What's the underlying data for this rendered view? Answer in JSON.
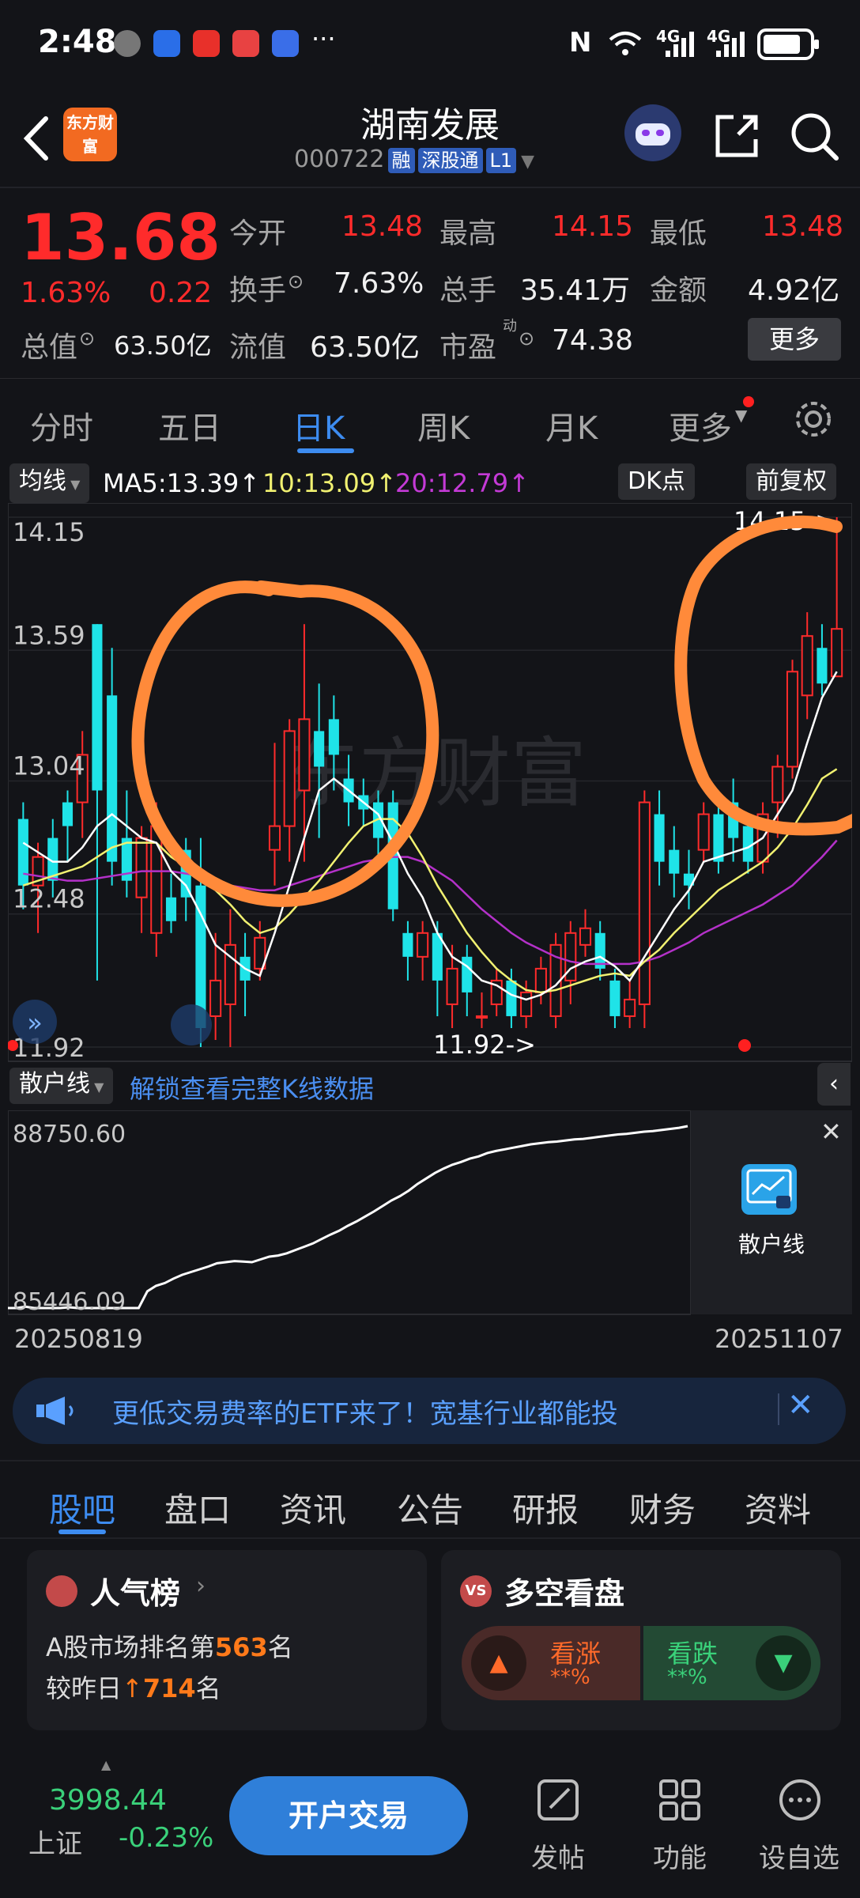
{
  "status_bar": {
    "time": "2:48",
    "signal_1": "4G",
    "signal_2": "4G"
  },
  "header": {
    "logo_text": "东方财富",
    "title": "湖南发展",
    "code": "000722",
    "tags": [
      "融",
      "深股通",
      "L1"
    ]
  },
  "quote": {
    "price": "13.68",
    "change_pct": "1.63%",
    "change": "0.22",
    "fields": [
      {
        "label": "今开",
        "value": "13.48"
      },
      {
        "label": "最高",
        "value": "14.15"
      },
      {
        "label": "最低",
        "value": "13.48"
      },
      {
        "label": "换手",
        "value": "7.63%"
      },
      {
        "label": "总手",
        "value": "35.41万"
      },
      {
        "label": "金额",
        "value": "4.92亿"
      },
      {
        "label": "总值",
        "value": "63.50亿"
      },
      {
        "label": "流值",
        "value": "63.50亿"
      },
      {
        "label": "市盈",
        "sup": "动",
        "value": "74.38"
      }
    ],
    "more_label": "更多"
  },
  "period_tabs": {
    "items": [
      "分时",
      "五日",
      "日K",
      "周K",
      "月K",
      "更多"
    ],
    "active": "日K"
  },
  "indicator_bar": {
    "selector": "均线",
    "ma5": "MA5:13.39",
    "ma10": "10:13.09",
    "ma20": "20:12.79",
    "dk_label": "DK点",
    "fq_label": "前复权"
  },
  "sub_indicator": {
    "selector": "散户线",
    "unlock_text": "解锁查看完整K线数据",
    "panel_label": "散户线"
  },
  "chart_data": [
    {
      "type": "candlestick",
      "axis_ticks": [
        "14.15",
        "13.59",
        "13.04",
        "12.48",
        "11.92"
      ],
      "ylim": [
        11.92,
        14.15
      ],
      "annotations": [
        "14.15->",
        "11.92->"
      ],
      "watermark": "东方财富",
      "candles": [
        {
          "o": 12.88,
          "c": 12.6,
          "h": 12.95,
          "l": 12.5
        },
        {
          "o": 12.6,
          "c": 12.72,
          "h": 12.78,
          "l": 12.4
        },
        {
          "o": 12.8,
          "c": 12.62,
          "h": 12.88,
          "l": 12.55
        },
        {
          "o": 12.95,
          "c": 12.85,
          "h": 13.0,
          "l": 12.7
        },
        {
          "o": 12.95,
          "c": 13.15,
          "h": 13.25,
          "l": 12.8
        },
        {
          "o": 13.7,
          "c": 13.0,
          "h": 13.7,
          "l": 12.2
        },
        {
          "o": 13.4,
          "c": 12.7,
          "h": 13.6,
          "l": 12.6
        },
        {
          "o": 12.8,
          "c": 12.62,
          "h": 13.0,
          "l": 12.55
        },
        {
          "o": 12.55,
          "c": 12.8,
          "h": 12.85,
          "l": 12.4
        },
        {
          "o": 12.4,
          "c": 12.85,
          "h": 12.95,
          "l": 12.3
        },
        {
          "o": 12.55,
          "c": 12.45,
          "h": 12.65,
          "l": 12.4
        },
        {
          "o": 12.75,
          "c": 12.55,
          "h": 12.8,
          "l": 12.45
        },
        {
          "o": 12.6,
          "c": 12.0,
          "h": 12.8,
          "l": 11.92
        },
        {
          "o": 12.05,
          "c": 12.2,
          "h": 12.4,
          "l": 11.95
        },
        {
          "o": 12.1,
          "c": 12.35,
          "h": 12.5,
          "l": 11.92
        },
        {
          "o": 12.3,
          "c": 12.2,
          "h": 12.4,
          "l": 12.05
        },
        {
          "o": 12.25,
          "c": 12.38,
          "h": 12.45,
          "l": 12.2
        },
        {
          "o": 12.75,
          "c": 12.85,
          "h": 13.2,
          "l": 12.6
        },
        {
          "o": 12.85,
          "c": 13.25,
          "h": 13.3,
          "l": 12.7
        },
        {
          "o": 13.0,
          "c": 13.3,
          "h": 13.7,
          "l": 12.7
        },
        {
          "o": 13.25,
          "c": 13.1,
          "h": 13.45,
          "l": 12.8
        },
        {
          "o": 13.3,
          "c": 13.15,
          "h": 13.4,
          "l": 13.0
        },
        {
          "o": 13.05,
          "c": 12.95,
          "h": 13.15,
          "l": 12.85
        },
        {
          "o": 12.98,
          "c": 12.92,
          "h": 13.05,
          "l": 12.85
        },
        {
          "o": 12.95,
          "c": 12.8,
          "h": 13.0,
          "l": 12.7
        },
        {
          "o": 12.95,
          "c": 12.5,
          "h": 13.0,
          "l": 12.45
        },
        {
          "o": 12.4,
          "c": 12.3,
          "h": 12.45,
          "l": 12.2
        },
        {
          "o": 12.3,
          "c": 12.4,
          "h": 12.45,
          "l": 12.2
        },
        {
          "o": 12.4,
          "c": 12.2,
          "h": 12.45,
          "l": 12.05
        },
        {
          "o": 12.1,
          "c": 12.25,
          "h": 12.35,
          "l": 12.0
        },
        {
          "o": 12.3,
          "c": 12.15,
          "h": 12.35,
          "l": 12.05
        },
        {
          "o": 12.05,
          "c": 12.05,
          "h": 12.15,
          "l": 12.0
        },
        {
          "o": 12.1,
          "c": 12.2,
          "h": 12.25,
          "l": 12.05
        },
        {
          "o": 12.2,
          "c": 12.05,
          "h": 12.25,
          "l": 12.0
        },
        {
          "o": 12.05,
          "c": 12.15,
          "h": 12.2,
          "l": 12.0
        },
        {
          "o": 12.15,
          "c": 12.25,
          "h": 12.3,
          "l": 12.1
        },
        {
          "o": 12.05,
          "c": 12.35,
          "h": 12.4,
          "l": 12.0
        },
        {
          "o": 12.2,
          "c": 12.4,
          "h": 12.45,
          "l": 12.1
        },
        {
          "o": 12.35,
          "c": 12.42,
          "h": 12.5,
          "l": 12.3
        },
        {
          "o": 12.4,
          "c": 12.25,
          "h": 12.45,
          "l": 12.2
        },
        {
          "o": 12.2,
          "c": 12.05,
          "h": 12.25,
          "l": 12.0
        },
        {
          "o": 12.05,
          "c": 12.12,
          "h": 12.2,
          "l": 12.0
        },
        {
          "o": 12.1,
          "c": 12.95,
          "h": 13.0,
          "l": 12.0
        },
        {
          "o": 12.9,
          "c": 12.7,
          "h": 13.0,
          "l": 12.6
        },
        {
          "o": 12.75,
          "c": 12.65,
          "h": 12.85,
          "l": 12.55
        },
        {
          "o": 12.65,
          "c": 12.6,
          "h": 12.75,
          "l": 12.5
        },
        {
          "o": 12.75,
          "c": 12.9,
          "h": 12.95,
          "l": 12.7
        },
        {
          "o": 12.9,
          "c": 12.7,
          "h": 12.95,
          "l": 12.65
        },
        {
          "o": 12.95,
          "c": 12.8,
          "h": 13.05,
          "l": 12.7
        },
        {
          "o": 12.85,
          "c": 12.7,
          "h": 12.9,
          "l": 12.65
        },
        {
          "o": 12.7,
          "c": 12.9,
          "h": 12.95,
          "l": 12.65
        },
        {
          "o": 12.95,
          "c": 13.1,
          "h": 13.15,
          "l": 12.8
        },
        {
          "o": 13.1,
          "c": 13.5,
          "h": 13.55,
          "l": 13.05
        },
        {
          "o": 13.4,
          "c": 13.65,
          "h": 13.75,
          "l": 13.3
        },
        {
          "o": 13.6,
          "c": 13.45,
          "h": 13.7,
          "l": 13.4
        },
        {
          "o": 13.48,
          "c": 13.68,
          "h": 14.15,
          "l": 13.48
        }
      ],
      "ma5": [
        12.78,
        12.74,
        12.7,
        12.7,
        12.76,
        12.85,
        12.9,
        12.85,
        12.8,
        12.78,
        12.66,
        12.6,
        12.48,
        12.35,
        12.3,
        12.25,
        12.22,
        12.4,
        12.6,
        12.8,
        13.0,
        13.05,
        13.0,
        12.95,
        12.9,
        12.78,
        12.65,
        12.55,
        12.4,
        12.3,
        12.26,
        12.2,
        12.18,
        12.14,
        12.12,
        12.14,
        12.18,
        12.25,
        12.28,
        12.3,
        12.26,
        12.2,
        12.3,
        12.4,
        12.5,
        12.58,
        12.7,
        12.72,
        12.74,
        12.76,
        12.8,
        12.9,
        13.0,
        13.2,
        13.39,
        13.5
      ],
      "ma10": [
        12.6,
        12.62,
        12.64,
        12.66,
        12.68,
        12.72,
        12.76,
        12.78,
        12.78,
        12.78,
        12.72,
        12.68,
        12.62,
        12.58,
        12.52,
        12.45,
        12.4,
        12.42,
        12.48,
        12.55,
        12.62,
        12.7,
        12.78,
        12.85,
        12.88,
        12.88,
        12.82,
        12.72,
        12.6,
        12.5,
        12.4,
        12.32,
        12.25,
        12.2,
        12.16,
        12.15,
        12.16,
        12.18,
        12.2,
        12.22,
        12.23,
        12.22,
        12.28,
        12.33,
        12.4,
        12.46,
        12.52,
        12.58,
        12.62,
        12.66,
        12.7,
        12.76,
        12.84,
        12.94,
        13.05,
        13.09
      ],
      "ma20": [
        12.65,
        12.64,
        12.63,
        12.62,
        12.62,
        12.63,
        12.64,
        12.65,
        12.66,
        12.66,
        12.66,
        12.65,
        12.64,
        12.62,
        12.6,
        12.59,
        12.58,
        12.58,
        12.6,
        12.62,
        12.64,
        12.66,
        12.68,
        12.7,
        12.71,
        12.72,
        12.72,
        12.7,
        12.66,
        12.62,
        12.56,
        12.5,
        12.45,
        12.4,
        12.36,
        12.33,
        12.3,
        12.28,
        12.27,
        12.27,
        12.27,
        12.27,
        12.28,
        12.3,
        12.33,
        12.36,
        12.4,
        12.43,
        12.46,
        12.49,
        12.52,
        12.56,
        12.6,
        12.66,
        12.72,
        12.79
      ]
    },
    {
      "type": "line",
      "name": "散户线",
      "axis_ticks": [
        "88750.60",
        "85446.09"
      ],
      "ylim": [
        85446.09,
        88750.6
      ],
      "x_start_label": "20250819",
      "x_end_label": "20251107",
      "values": [
        85446,
        85446,
        85470,
        85446,
        85446,
        85446,
        85446,
        85460,
        85446,
        85446,
        85446,
        85446,
        85446,
        85446,
        85446,
        85446,
        85750,
        85850,
        85900,
        85980,
        86050,
        86100,
        86150,
        86200,
        86260,
        86280,
        86300,
        86290,
        86280,
        86330,
        86380,
        86400,
        86440,
        86500,
        86560,
        86620,
        86700,
        86780,
        86850,
        86940,
        87020,
        87110,
        87200,
        87300,
        87400,
        87480,
        87580,
        87700,
        87800,
        87900,
        87980,
        88050,
        88100,
        88160,
        88200,
        88260,
        88300,
        88330,
        88360,
        88390,
        88420,
        88440,
        88460,
        88470,
        88490,
        88510,
        88520,
        88540,
        88560,
        88580,
        88600,
        88610,
        88630,
        88650,
        88660,
        88680,
        88700,
        88720,
        88750
      ]
    }
  ],
  "banner": {
    "text": "更低交易费率的ETF来了！宽基行业都能投"
  },
  "bottom_tabs": {
    "items": [
      "股吧",
      "盘口",
      "资讯",
      "公告",
      "研报",
      "财务",
      "资料"
    ],
    "active": "股吧"
  },
  "popularity": {
    "title": "人气榜",
    "line1_prefix": "A股市场排名第",
    "rank": "563",
    "line1_suffix": "名",
    "line2_prefix": "较昨日",
    "change": "714",
    "line2_suffix": "名"
  },
  "sentiment": {
    "title": "多空看盘",
    "bull_label": "看涨",
    "bull_value": "**%",
    "bear_label": "看跌",
    "bear_value": "**%"
  },
  "footer": {
    "index_value": "3998.44",
    "index_name": "上证",
    "index_change": "-0.23%",
    "open_account": "开户交易",
    "actions": [
      "发帖",
      "功能",
      "设自选"
    ]
  },
  "colors": {
    "up": "#ff2b2b",
    "down": "#1fe3e8",
    "ma5": "#ffffff",
    "ma10": "#f1f171",
    "ma20": "#b431c9",
    "highlight": "#ff8a3a"
  }
}
